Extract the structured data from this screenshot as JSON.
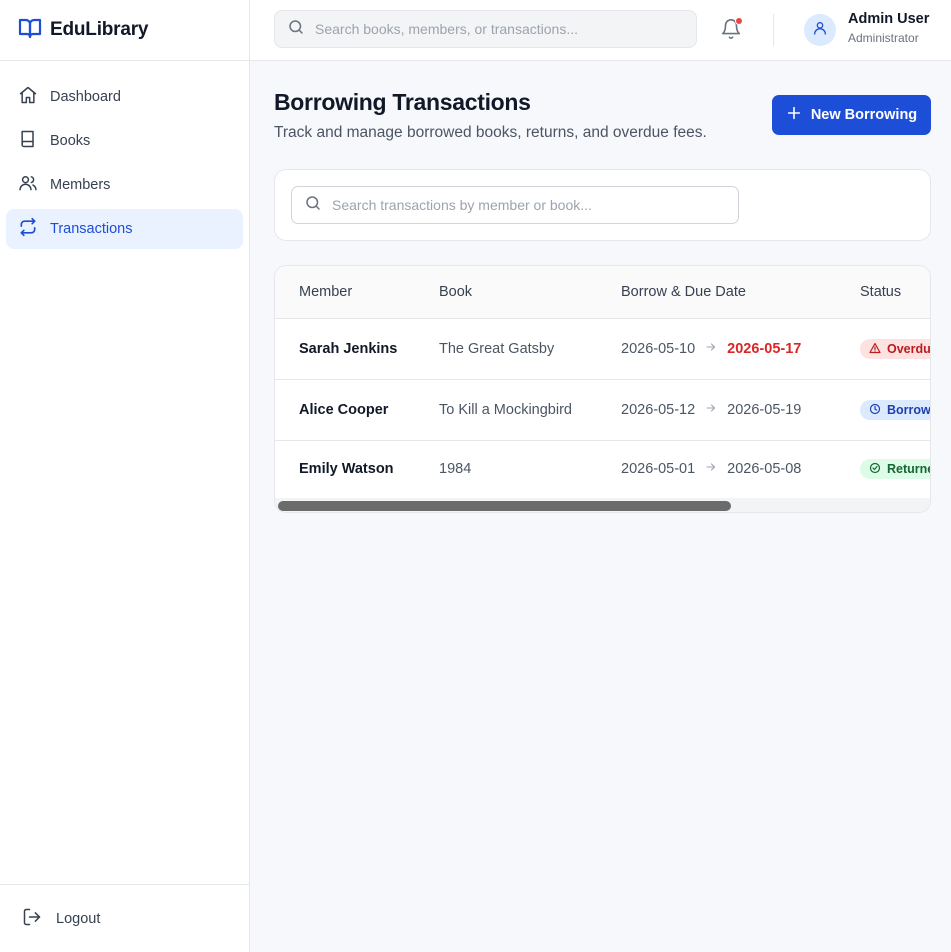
{
  "app": {
    "name": "EduLibrary",
    "accent": "#1d4ed8"
  },
  "sidebar": {
    "items": [
      {
        "label": "Dashboard",
        "icon": "home-icon"
      },
      {
        "label": "Books",
        "icon": "book-icon"
      },
      {
        "label": "Members",
        "icon": "users-icon"
      },
      {
        "label": "Transactions",
        "icon": "swap-arrows-icon",
        "active": true
      }
    ],
    "logout_label": "Logout"
  },
  "topbar": {
    "search_placeholder": "Search books, members, or transactions...",
    "notifications_unread": true,
    "user": {
      "name": "Admin User",
      "role": "Administrator"
    }
  },
  "page": {
    "title": "Borrowing Transactions",
    "subtitle": "Track and manage borrowed books, returns, and overdue fees.",
    "new_button_label": "New Borrowing",
    "filter_placeholder": "Search transactions by member or book..."
  },
  "table": {
    "headers": {
      "member": "Member",
      "book": "Book",
      "dates": "Borrow & Due Date",
      "status": "Status"
    },
    "rows": [
      {
        "member": "Sarah Jenkins",
        "book": "The Great Gatsby",
        "borrow_date": "2026-05-10",
        "due_date": "2026-05-17",
        "status": "Overdue",
        "status_kind": "overdue"
      },
      {
        "member": "Alice Cooper",
        "book": "To Kill a Mockingbird",
        "borrow_date": "2026-05-12",
        "due_date": "2026-05-19",
        "status": "Borrowed",
        "status_kind": "borrowed"
      },
      {
        "member": "Emily Watson",
        "book": "1984",
        "borrow_date": "2026-05-01",
        "due_date": "2026-05-08",
        "status": "Returned",
        "status_kind": "returned"
      }
    ]
  },
  "colors": {
    "overdue": "#dc2626",
    "borrowed": "#1e40af",
    "returned": "#166534"
  }
}
